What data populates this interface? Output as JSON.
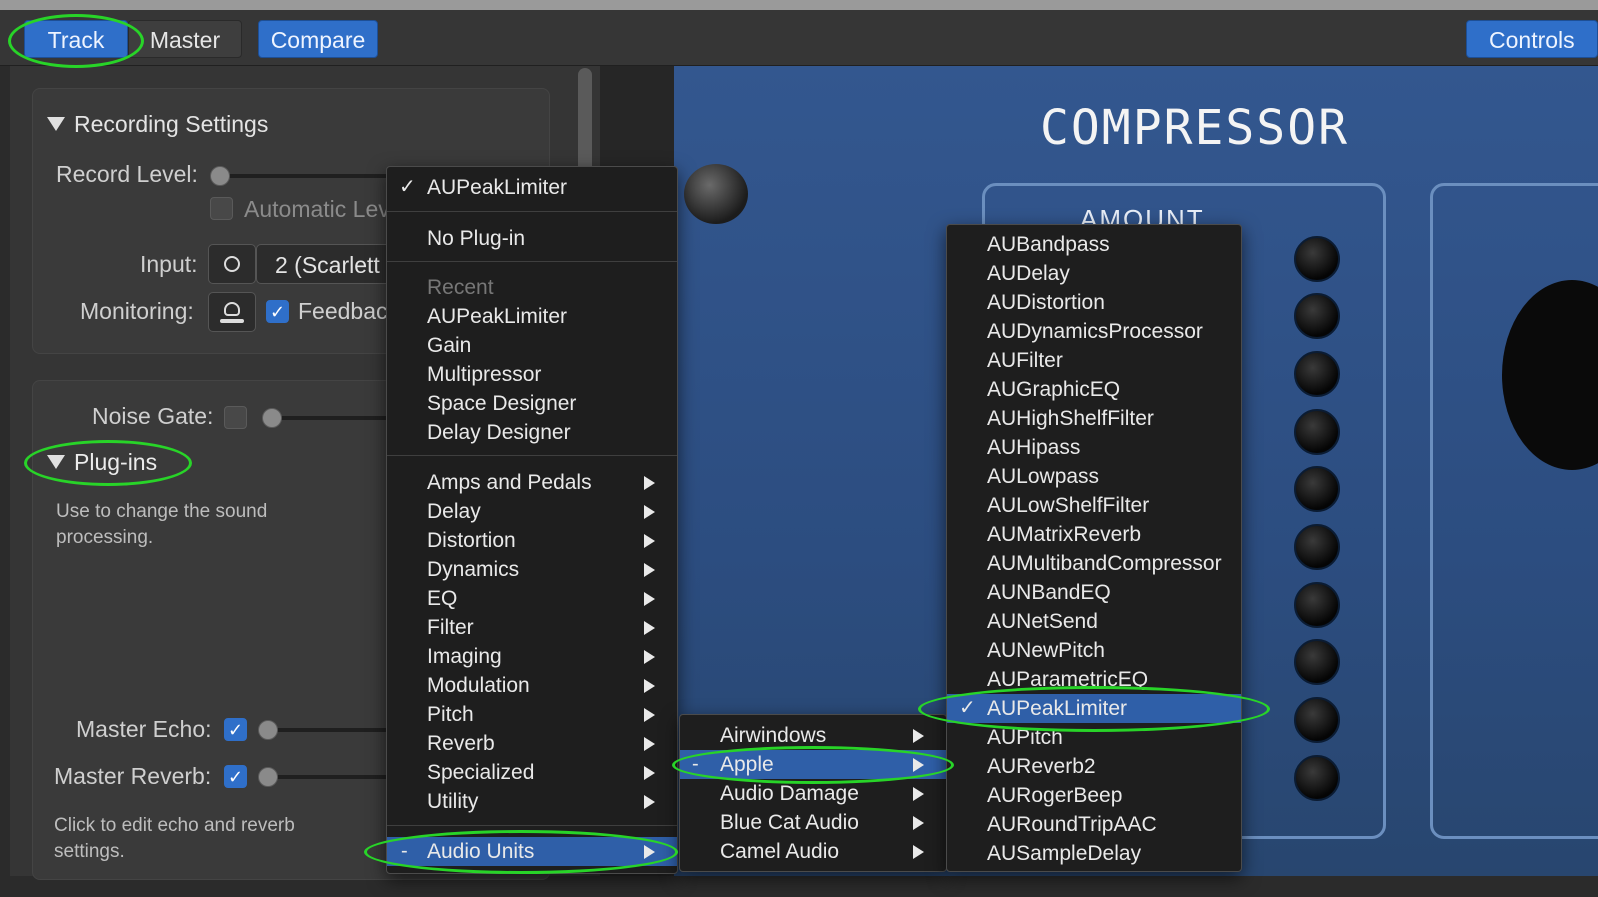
{
  "topbar": {
    "track_label": "Track",
    "master_label": "Master",
    "compare_label": "Compare",
    "controls_label": "Controls"
  },
  "left": {
    "recording_settings": "Recording Settings",
    "record_level": "Record Level:",
    "automatic_level": "Automatic Level",
    "input_label": "Input:",
    "input_value": "2  (Scarlett",
    "monitoring_label": "Monitoring:",
    "feedback_label": "Feedback",
    "noise_gate": "Noise Gate:",
    "plugins": "Plug-ins",
    "plugins_help": "Use to change the sound processing.",
    "master_echo": "Master Echo:",
    "master_reverb": "Master Reverb:",
    "echo_help": "Click to edit echo and reverb settings."
  },
  "plugin": {
    "title": "COMPRESSOR",
    "amount_label": "AMOUNT"
  },
  "menu_main": {
    "current": "AUPeakLimiter",
    "check": "✓",
    "no_plugin": "No Plug-in",
    "recent_header": "Recent",
    "recent": [
      "AUPeakLimiter",
      "Gain",
      "Multipressor",
      "Space Designer",
      "Delay Designer"
    ],
    "categories": [
      "Amps and Pedals",
      "Delay",
      "Distortion",
      "Dynamics",
      "EQ",
      "Filter",
      "Imaging",
      "Modulation",
      "Pitch",
      "Reverb",
      "Specialized",
      "Utility"
    ],
    "audio_units": "Audio Units",
    "dash": "-"
  },
  "menu_manufacturers": {
    "items": [
      "Airwindows",
      "Apple",
      "Audio Damage",
      "Blue Cat Audio",
      "Camel Audio"
    ],
    "selected_dash": "-"
  },
  "menu_apple": {
    "items": [
      "AUBandpass",
      "AUDelay",
      "AUDistortion",
      "AUDynamicsProcessor",
      "AUFilter",
      "AUGraphicEQ",
      "AUHighShelfFilter",
      "AUHipass",
      "AULowpass",
      "AULowShelfFilter",
      "AUMatrixReverb",
      "AUMultibandCompressor",
      "AUNBandEQ",
      "AUNetSend",
      "AUNewPitch",
      "AUParametricEQ",
      "AUPeakLimiter",
      "AUPitch",
      "AUReverb2",
      "AURogerBeep",
      "AURoundTripAAC",
      "AUSampleDelay"
    ],
    "check": "✓"
  },
  "colors": {
    "accent": "#2f6fc9",
    "highlight": "#2f5fa8",
    "annotation": "#28d428",
    "plugin_bg": "#2c4d80"
  }
}
